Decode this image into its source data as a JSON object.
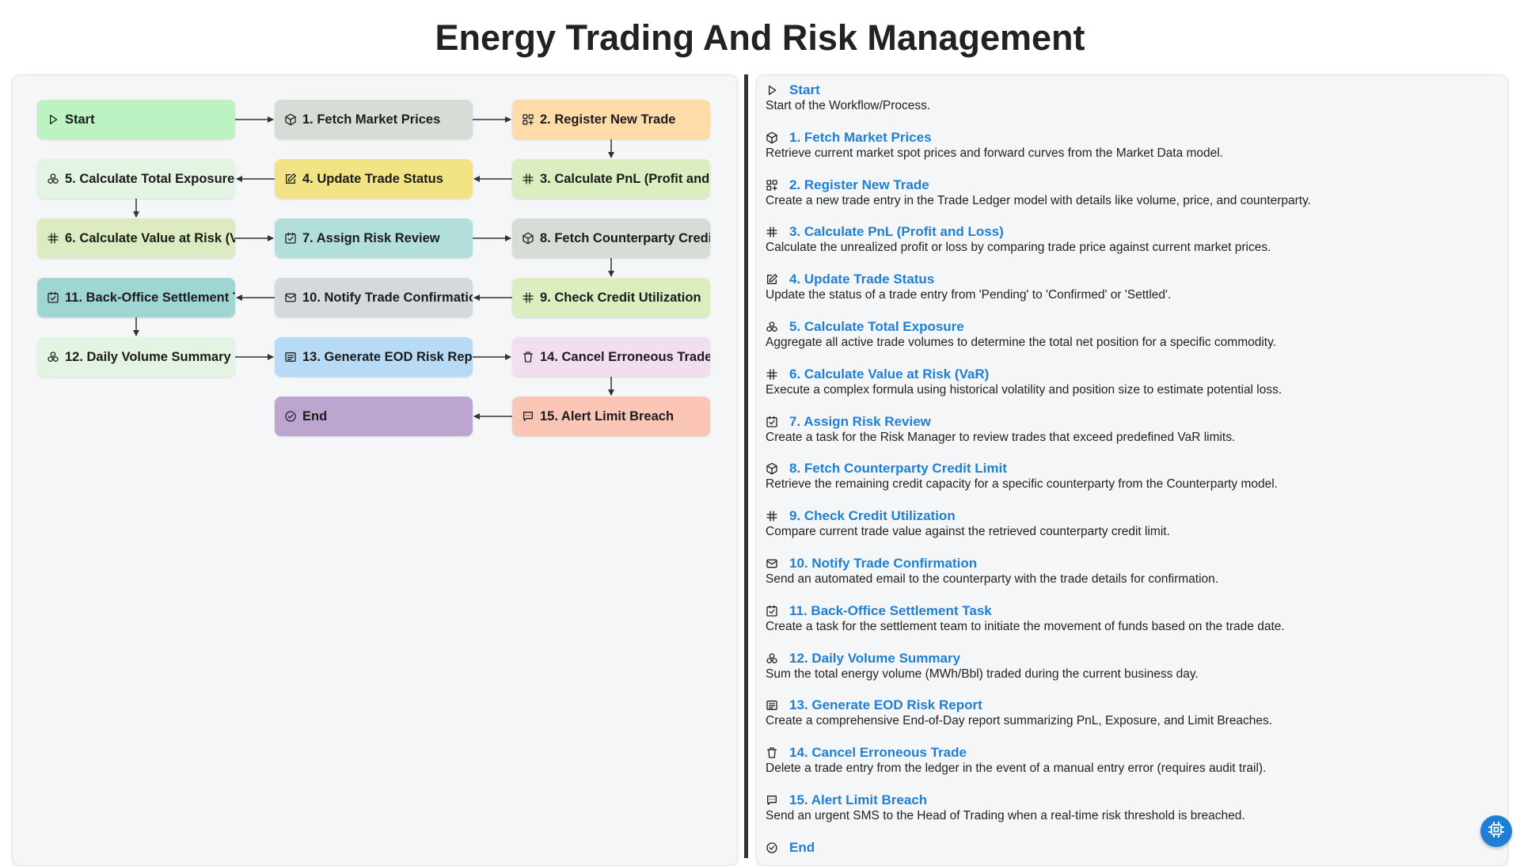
{
  "title": "Energy Trading And Risk Management",
  "colors": {
    "link": "#1f7fd6",
    "start": "#bdf2c2",
    "fetch": "#d5ddd6",
    "register": "#fddcaa",
    "calc_pnl": "#dceebf",
    "update": "#f2e485",
    "exposure": "#e4f4e2",
    "var": "#dcecc0",
    "assign": "#b2dfd9",
    "fetch_cp": "#d5ddd6",
    "check": "#dceebf",
    "notify": "#d5d9dc",
    "backoffice": "#9fd6d3",
    "daily": "#e4f4e2",
    "eod": "#b7dbf7",
    "cancel": "#f1dff0",
    "end": "#bca6cf",
    "alert": "#fcc6b6"
  },
  "nodes": [
    {
      "id": "start",
      "label": "Start",
      "icon": "play-icon"
    },
    {
      "id": "n1",
      "label": "1. Fetch Market Prices",
      "icon": "cube-icon"
    },
    {
      "id": "n2",
      "label": "2. Register New Trade",
      "icon": "grid-plus-icon"
    },
    {
      "id": "n3",
      "label": "3. Calculate PnL (Profit and Loss)",
      "icon": "hash-icon"
    },
    {
      "id": "n4",
      "label": "4. Update Trade Status",
      "icon": "edit-icon"
    },
    {
      "id": "n5",
      "label": "5. Calculate Total Exposure",
      "icon": "aggregate-icon"
    },
    {
      "id": "n6",
      "label": "6. Calculate Value at Risk (VaR)",
      "icon": "hash-icon"
    },
    {
      "id": "n7",
      "label": "7. Assign Risk Review",
      "icon": "checkbox-icon"
    },
    {
      "id": "n8",
      "label": "8. Fetch Counterparty Credit Limit",
      "icon": "cube-icon"
    },
    {
      "id": "n9",
      "label": "9. Check Credit Utilization",
      "icon": "hash-icon"
    },
    {
      "id": "n10",
      "label": "10. Notify Trade Confirmation",
      "icon": "mail-icon"
    },
    {
      "id": "n11",
      "label": "11. Back-Office Settlement Task",
      "icon": "checkbox-icon"
    },
    {
      "id": "n12",
      "label": "12. Daily Volume Summary",
      "icon": "aggregate-icon"
    },
    {
      "id": "n13",
      "label": "13. Generate EOD Risk Report",
      "icon": "report-icon"
    },
    {
      "id": "n14",
      "label": "14. Cancel Erroneous Trade",
      "icon": "trash-icon"
    },
    {
      "id": "n15",
      "label": "15. Alert Limit Breach",
      "icon": "sms-icon"
    },
    {
      "id": "end",
      "label": "End",
      "icon": "check-circle-icon"
    }
  ],
  "steps": [
    {
      "title": "Start",
      "desc": "Start of the Workflow/Process.",
      "icon": "play-icon"
    },
    {
      "title": "1. Fetch Market Prices",
      "desc": "Retrieve current market spot prices and forward curves from the Market Data model.",
      "icon": "cube-icon"
    },
    {
      "title": "2. Register New Trade",
      "desc": "Create a new trade entry in the Trade Ledger model with details like volume, price, and counterparty.",
      "icon": "grid-plus-icon"
    },
    {
      "title": "3. Calculate PnL (Profit and Loss)",
      "desc": "Calculate the unrealized profit or loss by comparing trade price against current market prices.",
      "icon": "hash-icon"
    },
    {
      "title": "4. Update Trade Status",
      "desc": "Update the status of a trade entry from 'Pending' to 'Confirmed' or 'Settled'.",
      "icon": "edit-icon"
    },
    {
      "title": "5. Calculate Total Exposure",
      "desc": "Aggregate all active trade volumes to determine the total net position for a specific commodity.",
      "icon": "aggregate-icon"
    },
    {
      "title": "6. Calculate Value at Risk (VaR)",
      "desc": "Execute a complex formula using historical volatility and position size to estimate potential loss.",
      "icon": "hash-icon"
    },
    {
      "title": "7. Assign Risk Review",
      "desc": "Create a task for the Risk Manager to review trades that exceed predefined VaR limits.",
      "icon": "checkbox-icon"
    },
    {
      "title": "8. Fetch Counterparty Credit Limit",
      "desc": "Retrieve the remaining credit capacity for a specific counterparty from the Counterparty model.",
      "icon": "cube-icon"
    },
    {
      "title": "9. Check Credit Utilization",
      "desc": "Compare current trade value against the retrieved counterparty credit limit.",
      "icon": "hash-icon"
    },
    {
      "title": "10. Notify Trade Confirmation",
      "desc": "Send an automated email to the counterparty with the trade details for confirmation.",
      "icon": "mail-icon"
    },
    {
      "title": "11. Back-Office Settlement Task",
      "desc": "Create a task for the settlement team to initiate the movement of funds based on the trade date.",
      "icon": "checkbox-icon"
    },
    {
      "title": "12. Daily Volume Summary",
      "desc": "Sum the total energy volume (MWh/Bbl) traded during the current business day.",
      "icon": "aggregate-icon"
    },
    {
      "title": "13. Generate EOD Risk Report",
      "desc": "Create a comprehensive End-of-Day report summarizing PnL, Exposure, and Limit Breaches.",
      "icon": "report-icon"
    },
    {
      "title": "14. Cancel Erroneous Trade",
      "desc": "Delete a trade entry from the ledger in the event of a manual entry error (requires audit trail).",
      "icon": "trash-icon"
    },
    {
      "title": "15. Alert Limit Breach",
      "desc": "Send an urgent SMS to the Head of Trading when a real-time risk threshold is breached.",
      "icon": "sms-icon"
    },
    {
      "title": "End",
      "desc": "",
      "icon": "check-circle-icon"
    }
  ],
  "fab_icon": "chip-icon"
}
